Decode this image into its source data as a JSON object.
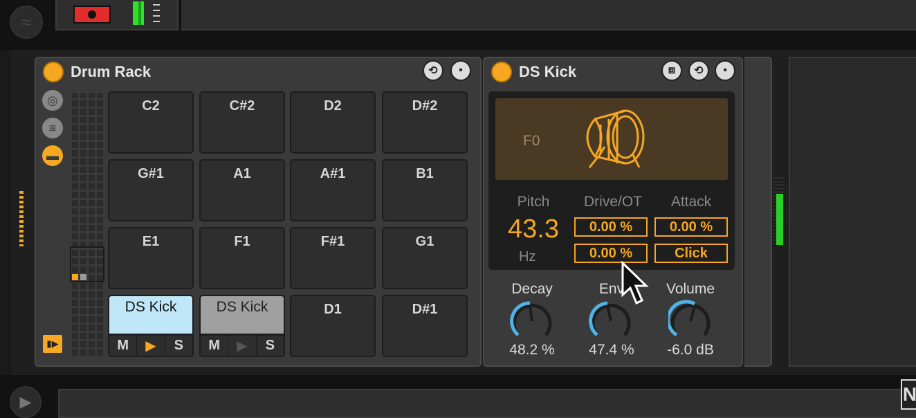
{
  "top": {
    "record_icon": "record-icon",
    "meter_color": "#2ce02c"
  },
  "drum_rack": {
    "title": "Drum Rack",
    "side_icons": [
      "chain-icon",
      "list-icon",
      "pad-view-icon"
    ],
    "pads": [
      {
        "label": "C2"
      },
      {
        "label": "C#2"
      },
      {
        "label": "D2"
      },
      {
        "label": "D#2"
      },
      {
        "label": "G#1"
      },
      {
        "label": "A1"
      },
      {
        "label": "A#1"
      },
      {
        "label": "B1"
      },
      {
        "label": "E1"
      },
      {
        "label": "F1"
      },
      {
        "label": "F#1"
      },
      {
        "label": "G1"
      },
      {
        "label": "DS Kick"
      },
      {
        "label": "DS Kick"
      },
      {
        "label": "D1"
      },
      {
        "label": "D#1"
      }
    ],
    "pad_controls": {
      "mute": "M",
      "play": "▶",
      "solo": "S"
    }
  },
  "ds_kick": {
    "title": "DS Kick",
    "note": "F0",
    "pitch_label": "Pitch",
    "pitch_value": "43.3",
    "pitch_unit": "Hz",
    "drive_label": "Drive/OT",
    "attack_label": "Attack",
    "drive_value": "0.00 %",
    "ot_value": "0.00 %",
    "attack_value": "0.00 %",
    "click_label": "Click",
    "decay_label": "Decay",
    "decay_value": "48.2 %",
    "env_label": "Env",
    "env_value": "47.4 %",
    "volume_label": "Volume",
    "volume_value": "-6.0 dB"
  },
  "colors": {
    "accent": "#f7a823",
    "selected_pad": "#bfe7f8",
    "knob_blue": "#4fb3e8"
  }
}
